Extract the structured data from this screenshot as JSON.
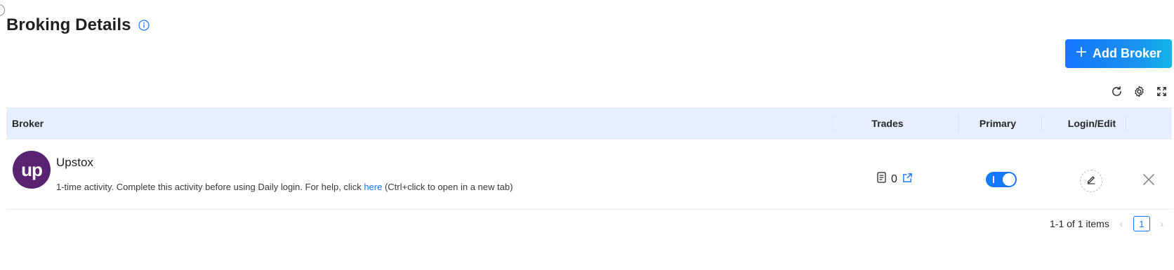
{
  "page": {
    "title": "Broking Details",
    "add_broker_label": "Add Broker"
  },
  "table": {
    "columns": {
      "broker": "Broker",
      "trades": "Trades",
      "primary": "Primary",
      "login_edit": "Login/Edit"
    },
    "rows": [
      {
        "logo_text": "up",
        "name": "Upstox",
        "note_prefix": "1-time activity. Complete this activity before using Daily login. For help, click ",
        "note_link": "here",
        "note_suffix": " (Ctrl+click to open in a new tab)",
        "trades": "0",
        "primary": true
      }
    ]
  },
  "pagination": {
    "summary": "1-1 of 1 items",
    "current_page": "1"
  },
  "colors": {
    "accent": "#1677ff",
    "header_bg": "#e6efff",
    "logo_bg": "#5a2372"
  },
  "icons": {
    "title_info": "info-icon",
    "add": "plus-icon",
    "reload": "reload-icon",
    "settings": "gear-icon",
    "fullscreen": "fullscreen-icon",
    "trades_doc": "document-icon",
    "trades_open": "external-link-icon",
    "edit": "pencil-icon",
    "delete": "close-icon"
  }
}
